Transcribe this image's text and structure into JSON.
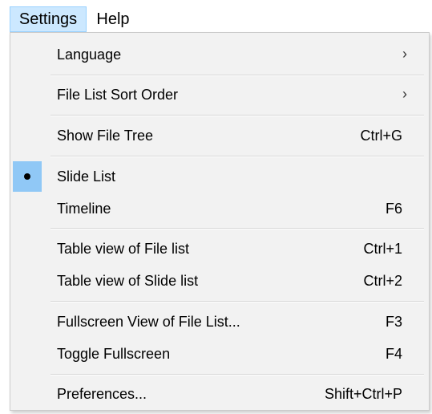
{
  "menubar": {
    "items": [
      {
        "label": "Settings"
      },
      {
        "label": "Help"
      }
    ]
  },
  "menu": {
    "groups": [
      {
        "items": [
          {
            "label": "Language",
            "submenu": true
          },
          {
            "label": "File List Sort Order",
            "submenu": true
          }
        ]
      },
      {
        "items": [
          {
            "label": "Show File Tree",
            "shortcut": "Ctrl+G"
          }
        ]
      },
      {
        "items": [
          {
            "label": "Slide List",
            "checked": true
          },
          {
            "label": "Timeline",
            "shortcut": "F6"
          }
        ]
      },
      {
        "items": [
          {
            "label": "Table view of File list",
            "shortcut": "Ctrl+1"
          },
          {
            "label": "Table view of Slide list",
            "shortcut": "Ctrl+2"
          }
        ]
      },
      {
        "items": [
          {
            "label": "Fullscreen View of File List...",
            "shortcut": "F3"
          },
          {
            "label": "Toggle Fullscreen",
            "shortcut": "F4"
          }
        ]
      },
      {
        "items": [
          {
            "label": "Preferences...",
            "shortcut": "Shift+Ctrl+P"
          }
        ]
      }
    ],
    "submenu_arrow_glyph": "›",
    "radio_icon": "bullet-icon"
  },
  "colors": {
    "menubar_selected_bg": "#cce8ff",
    "checked_gutter_bg": "#90c8f6",
    "menu_bg": "#f2f2f2"
  }
}
